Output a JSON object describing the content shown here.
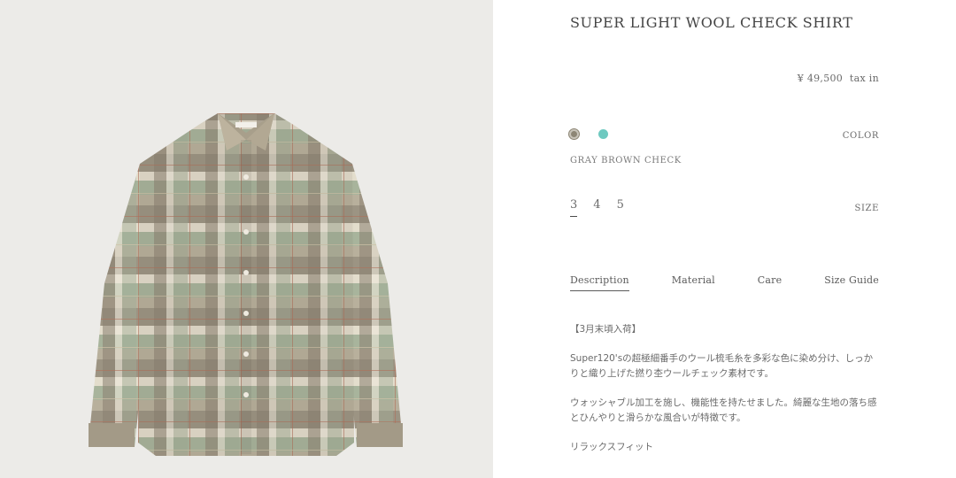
{
  "product": {
    "title": "SUPER LIGHT WOOL CHECK SHIRT",
    "price": "¥ 49,500",
    "tax_note": "tax in",
    "image_label": "AURALEE"
  },
  "colors": {
    "label": "COLOR",
    "selected_name": "GRAY BROWN CHECK",
    "swatches": [
      "#8d8675",
      "#6ec9c0"
    ]
  },
  "sizes": {
    "label": "SIZE",
    "options": [
      "3",
      "4",
      "5"
    ]
  },
  "tabs": [
    "Description",
    "Material",
    "Care",
    "Size Guide"
  ],
  "description": {
    "line1": "【3月末頃入荷】",
    "line2": "Super120'sの超極細番手のウール梳毛糸を多彩な色に染め分け、しっかりと織り上げた撚り杢ウールチェック素材です。",
    "line3": "ウォッシャブル加工を施し、機能性を持たせました。綺麗な生地の落ち感とひんやりと滑らかな風合いが特徴です。",
    "line4": "リラックスフィット"
  }
}
